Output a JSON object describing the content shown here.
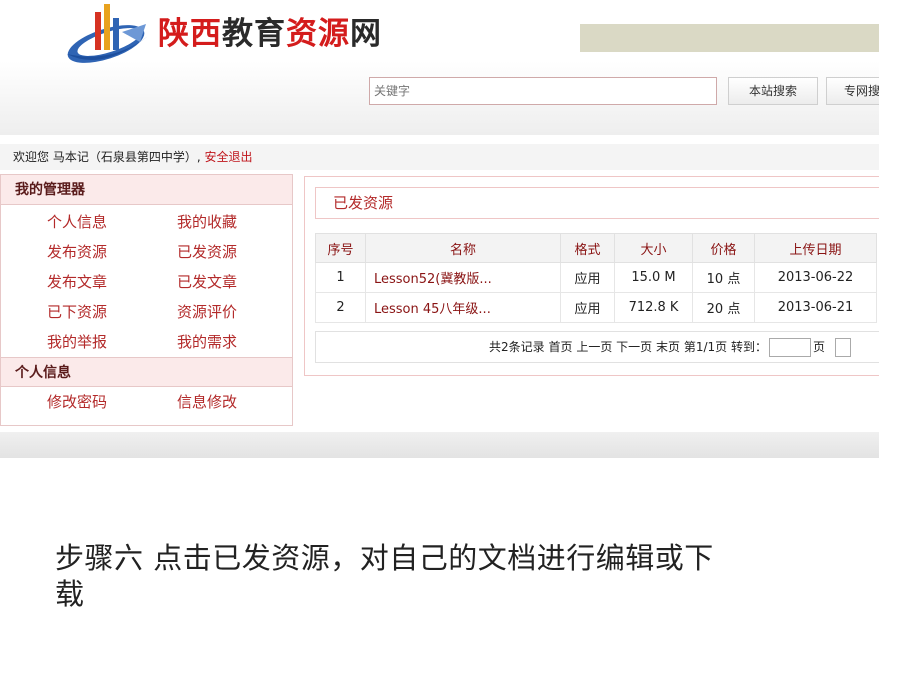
{
  "header": {
    "title_part1": "陕西",
    "title_part2": "教育",
    "title_part3": "资源",
    "title_part4": "网",
    "logo_icon": "swoosh-logo-icon",
    "search_placeholder": "关键字",
    "search_site_label": "本站搜索",
    "search_net_label": "专网搜",
    "accent_color": "#d41c1c"
  },
  "welcome": {
    "prefix": "欢迎您 ",
    "user": "马本记",
    "school": "（石泉县第四中学）,",
    "logout": "安全退出"
  },
  "sidebar": {
    "section1_title": "我的管理器",
    "section1_items": [
      "个人信息",
      "我的收藏",
      "发布资源",
      "已发资源",
      "发布文章",
      "已发文章",
      "已下资源",
      "资源评价",
      "我的举报",
      "我的需求"
    ],
    "section2_title": "个人信息",
    "section2_items": [
      "修改密码",
      "信息修改"
    ]
  },
  "main": {
    "tab_title": "已发资源",
    "columns": [
      "序号",
      "名称",
      "格式",
      "大小",
      "价格",
      "上传日期"
    ],
    "rows": [
      [
        "1",
        "Lesson52(冀教版...",
        "应用",
        "15.0 M",
        "10 点",
        "2013-06-22"
      ],
      [
        "2",
        "Lesson 45八年级...",
        "应用",
        "712.8 K",
        "20 点",
        "2013-06-21"
      ]
    ],
    "pager": {
      "total": "共2条记录",
      "first": "首页",
      "prev": "上一页",
      "next": "下一页",
      "last": "末页",
      "page": "第1/1页",
      "jump": "转到：",
      "unit": "页"
    }
  },
  "caption": {
    "line1": "步骤六  点击已发资源，对自己的文档进行编辑或下",
    "line2": "载"
  }
}
